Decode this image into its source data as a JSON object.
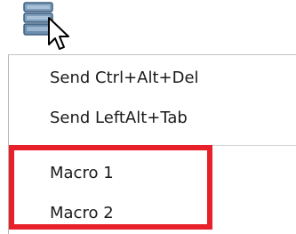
{
  "toolbar": {
    "button_icon": "window-stack-icon",
    "cursor_icon": "mouse-pointer-icon"
  },
  "menu": {
    "items": [
      {
        "label": "Send Ctrl+Alt+Del"
      },
      {
        "label": "Send LeftAlt+Tab"
      },
      {
        "label": "Macro 1"
      },
      {
        "label": "Macro 2"
      }
    ]
  },
  "colors": {
    "highlight": "#e8202a",
    "icon_fill": "#6d8fae",
    "separator": "#d6d6d6"
  }
}
